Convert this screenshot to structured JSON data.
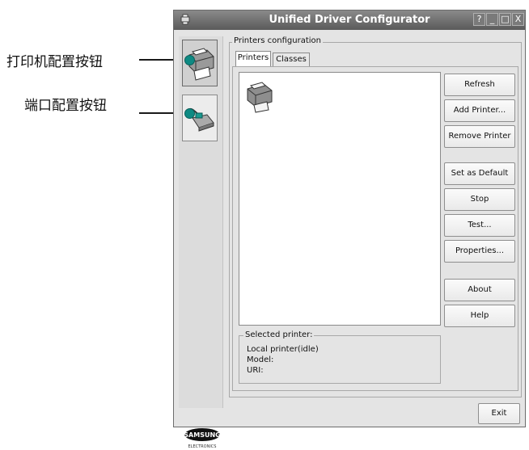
{
  "annotations": {
    "printer_config_button": "打印机配置按钮",
    "port_config_button": "端口配置按钮"
  },
  "window": {
    "title": "Unified Driver Configurator",
    "title_buttons": [
      "?",
      "_",
      "□",
      "X"
    ]
  },
  "main": {
    "group_title": "Printers configuration",
    "tabs": [
      {
        "label": "Printers",
        "active": true
      },
      {
        "label": "Classes",
        "active": false
      }
    ],
    "buttons": {
      "refresh": "Refresh",
      "add_printer": "Add Printer...",
      "remove_printer": "Remove Printer",
      "set_default": "Set as Default",
      "stop": "Stop",
      "test": "Test...",
      "properties": "Properties...",
      "about": "About",
      "help": "Help"
    },
    "selected": {
      "title": "Selected printer:",
      "lines": [
        "Local printer(idle)",
        "Model:",
        "URI:"
      ]
    }
  },
  "footer": {
    "exit": "Exit",
    "brand": "SAMSUNG",
    "brand_sub": "ELECTRONICS"
  },
  "colors": {
    "callout_dot": "#0e8a83",
    "titlebar": "#6e6e6e"
  }
}
